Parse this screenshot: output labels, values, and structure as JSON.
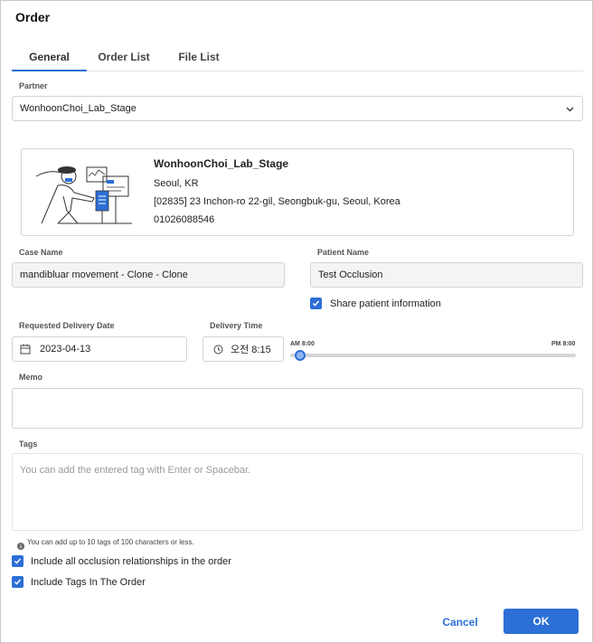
{
  "dialog": {
    "title": "Order"
  },
  "tabs": [
    {
      "label": "General",
      "active": true
    },
    {
      "label": "Order List",
      "active": false
    },
    {
      "label": "File List",
      "active": false
    }
  ],
  "partner": {
    "label": "Partner",
    "selected": "WonhoonChoi_Lab_Stage",
    "card": {
      "name": "WonhoonChoi_Lab_Stage",
      "location": "Seoul, KR",
      "address": "[02835] 23 Inchon-ro 22-gil, Seongbuk-gu, Seoul, Korea",
      "phone": "01026088546"
    }
  },
  "case_name": {
    "label": "Case Name",
    "value": "mandibluar movement - Clone - Clone"
  },
  "patient_name": {
    "label": "Patient Name",
    "value": "Test Occlusion"
  },
  "share_patient": {
    "label": "Share patient information",
    "checked": true
  },
  "delivery_date": {
    "label": "Requested Delivery Date",
    "value": "2023-04-13"
  },
  "delivery_time": {
    "label": "Delivery Time",
    "value": "오전 8:15",
    "slider_min_label": "AM 8:00",
    "slider_max_label": "PM 8:00",
    "slider_fraction": 0.02
  },
  "memo": {
    "label": "Memo",
    "value": ""
  },
  "tags": {
    "label": "Tags",
    "placeholder": "You can add the entered tag with Enter or Spacebar.",
    "hint": "You can add up to 10 tags of 100 characters or less."
  },
  "include_occlusion": {
    "label": "Include all occlusion relationships in the order",
    "checked": true
  },
  "include_tags": {
    "label": "Include Tags In The Order",
    "checked": true
  },
  "buttons": {
    "cancel": "Cancel",
    "ok": "OK"
  },
  "colors": {
    "accent": "#2c6fd6",
    "border": "#d3d3d3",
    "filled_bg": "#f3f4f6"
  }
}
